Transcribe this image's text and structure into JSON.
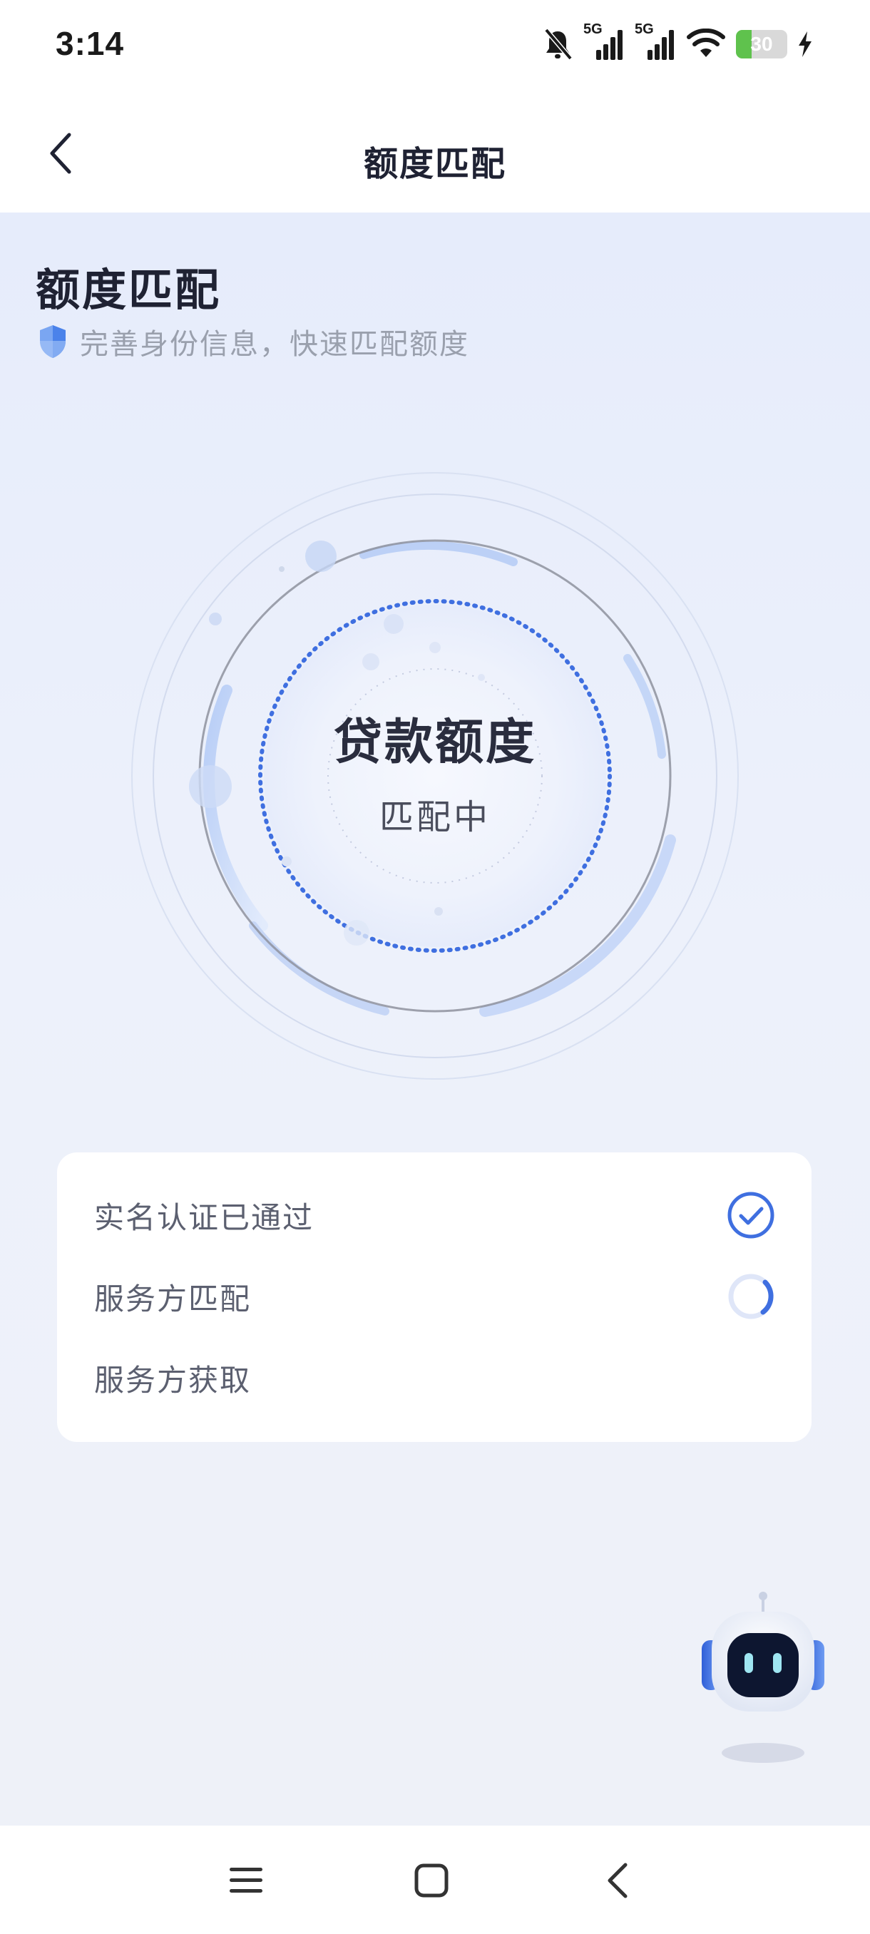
{
  "status_bar": {
    "time": "3:14",
    "network_1": "5G",
    "network_2": "5G",
    "battery_level": "30",
    "battery_percent": 30,
    "battery_color": "#5fc24d",
    "icons": [
      "bell-muted-icon",
      "signal-icon",
      "signal-icon",
      "wifi-icon",
      "battery-icon",
      "charging-icon"
    ]
  },
  "header": {
    "title": "额度匹配",
    "back_icon": "chevron-left-icon"
  },
  "main": {
    "title": "额度匹配",
    "subtitle": "完善身份信息，快速匹配额度",
    "subtitle_icon": "shield-icon",
    "accent_color": "#3f6fe0"
  },
  "radar": {
    "title": "贷款额度",
    "status": "匹配中"
  },
  "steps": [
    {
      "label": "实名认证已通过",
      "state": "done",
      "icon": "check-circle-icon"
    },
    {
      "label": "服务方匹配",
      "state": "loading",
      "icon": "spinner-icon"
    },
    {
      "label": "服务方获取",
      "state": "pending",
      "icon": ""
    }
  ],
  "assistant": {
    "icon": "robot-assistant-icon"
  },
  "nav_bar": {
    "icons": [
      "menu-icon",
      "home-icon",
      "back-icon"
    ]
  }
}
